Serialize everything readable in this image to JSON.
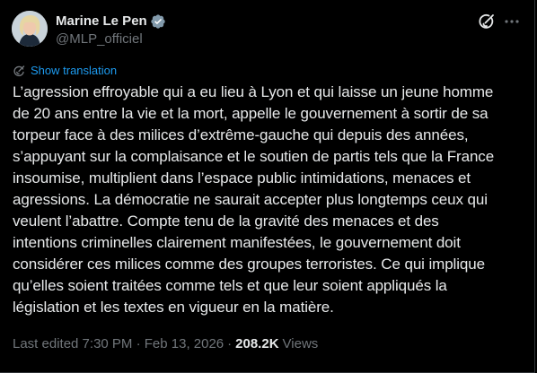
{
  "author": {
    "display_name": "Marine Le Pen",
    "handle": "@MLP_officiel",
    "verified": true,
    "verified_color": "#1d9bf0"
  },
  "header_actions": {
    "grok_icon": "grok-icon",
    "more_icon": "more-horizontal-icon"
  },
  "translation": {
    "label": "Show translation",
    "icon": "translate-icon",
    "color": "#1d9bf0"
  },
  "tweet": {
    "lines": [
      "L’agression effroyable qui a eu lieu à Lyon et qui laisse un jeune homme",
      "de 20 ans entre la vie et la mort, appelle le gouvernement à sortir de sa",
      "torpeur face à des milices d’extrême-gauche qui depuis des années,",
      "s’appuyant sur la complaisance et le soutien de partis tels que la France",
      "insoumise, multiplient dans l’espace public intimidations, menaces et",
      "agressions. La démocratie ne saurait accepter plus longtemps ceux qui",
      "veulent l’abattre. Compte tenu de la gravité des menaces et des",
      "intentions criminelles clairement manifestées, le gouvernement doit",
      "considérer ces milices comme des groupes terroristes. Ce qui implique",
      "qu’elles soient traitées comme tels et que leur soient appliqués la",
      "législation et les textes en vigueur en la matière."
    ]
  },
  "meta": {
    "edited": "Last edited 7:30 PM · Feb 13, 2026",
    "separator": "·",
    "views_count": "208.2K",
    "views_label": "Views"
  },
  "colors": {
    "background": "#000000",
    "text": "#e7e9ea",
    "secondary": "#71767b",
    "accent": "#1d9bf0"
  }
}
